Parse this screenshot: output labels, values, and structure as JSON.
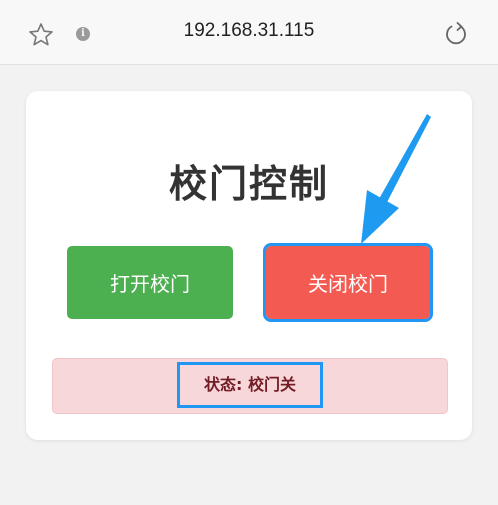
{
  "browser": {
    "url": "192.168.31.115",
    "star_icon": "star-icon",
    "info_icon": "info-icon",
    "reload_icon": "reload-icon"
  },
  "card": {
    "title": "校门控制",
    "open_button_label": "打开校门",
    "close_button_label": "关闭校门",
    "status_text": "状态: 校门关"
  },
  "colors": {
    "open_button": "#4caf50",
    "close_button": "#f35a52",
    "status_background": "#f8d7da",
    "status_text": "#721c24",
    "highlight": "#2196f3"
  }
}
